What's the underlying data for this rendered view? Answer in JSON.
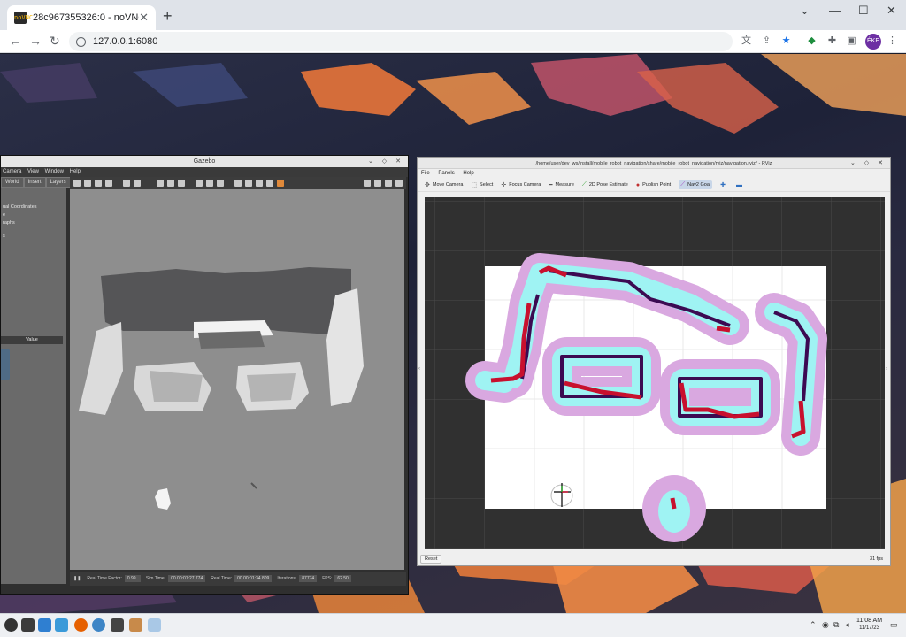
{
  "browser": {
    "tab_title": "28c967355326:0 - noVNC",
    "favicon_text": "noVNC",
    "url": "127.0.0.1:6080",
    "profile_initials": "ÉKE",
    "colors": {
      "accent": "#1a73e8",
      "profile": "#6d2fa3"
    }
  },
  "gazebo": {
    "title": "Gazebo",
    "menu": [
      "Camera",
      "View",
      "Window",
      "Help"
    ],
    "left_tabs": [
      "World",
      "Insert",
      "Layers"
    ],
    "tree_items": [
      "ual Coordinates",
      "e",
      "raphs",
      "s"
    ],
    "value_header": "Value",
    "status": {
      "real_time_factor_label": "Real Time Factor:",
      "real_time_factor": "0.99",
      "sim_time_label": "Sim Time:",
      "sim_time": "00 00:01:27.774",
      "real_time_label": "Real Time:",
      "real_time": "00 00:01:34.809",
      "iterations_label": "Iterations:",
      "iterations": "87774",
      "fps_label": "FPS:",
      "fps": "62.50"
    }
  },
  "rviz": {
    "title": "/home/user/dev_ws/install/mobile_robot_navigation/share/mobile_robot_navigation/rviz/navigation.rviz* - RViz",
    "menu": [
      "File",
      "Panels",
      "Help"
    ],
    "tools": [
      {
        "label": "Move Camera",
        "icon": "camera-icon"
      },
      {
        "label": "Select",
        "icon": "select-icon"
      },
      {
        "label": "Focus Camera",
        "icon": "focus-icon"
      },
      {
        "label": "Measure",
        "icon": "ruler-icon"
      },
      {
        "label": "2D Pose Estimate",
        "icon": "pose-arrow-icon"
      },
      {
        "label": "Publish Point",
        "icon": "pin-icon"
      },
      {
        "label": "Nav2 Goal",
        "icon": "goal-arrow-icon"
      }
    ],
    "reset_label": "Reset",
    "fps": "31 fps",
    "colors": {
      "map_bg": "#303030",
      "free": "#ffffff",
      "inflation": "#d9a8e0",
      "cyan": "#9ff3f3",
      "lethal": "#c8102e",
      "obstacle": "#3c0a52"
    }
  },
  "taskbar": {
    "time": "11:08 AM",
    "date": "11/17/23"
  }
}
